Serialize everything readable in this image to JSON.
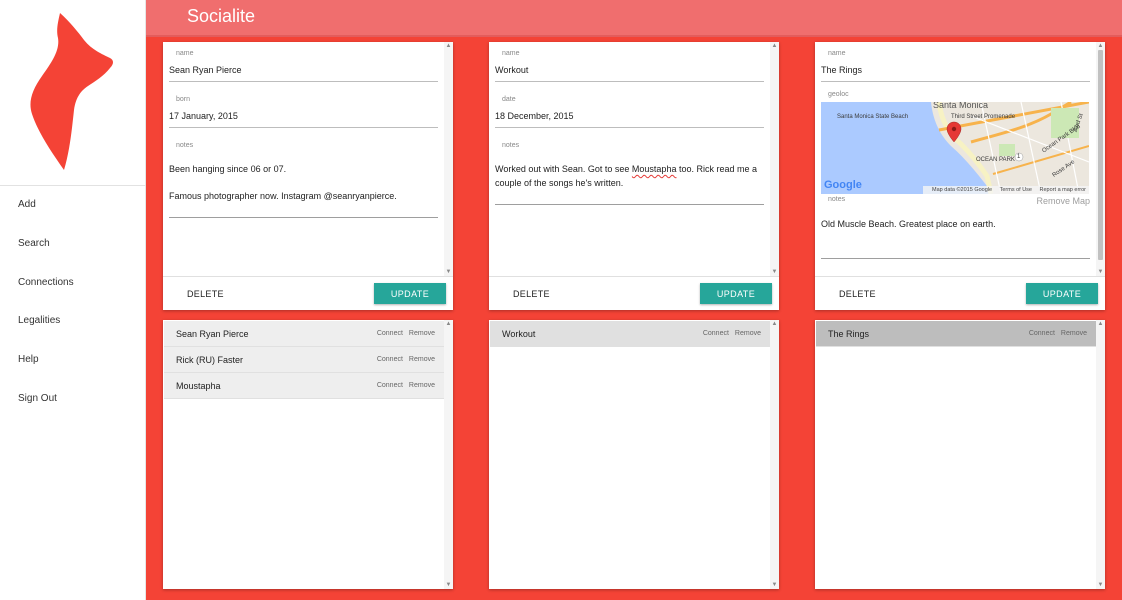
{
  "app": {
    "title": "Socialite"
  },
  "sidebar": {
    "items": [
      {
        "label": "Add"
      },
      {
        "label": "Search"
      },
      {
        "label": "Connections"
      },
      {
        "label": "Legalities"
      },
      {
        "label": "Help"
      },
      {
        "label": "Sign Out"
      }
    ]
  },
  "cards": [
    {
      "name_label": "name",
      "name_value": "Sean Ryan Pierce",
      "second_label": "born",
      "second_value": "17 January, 2015",
      "notes_label": "notes",
      "notes": [
        "Been hanging since 06 or 07.",
        "Famous photographer now. Instagram @seanryanpierce."
      ],
      "delete_label": "DELETE",
      "update_label": "UPDATE"
    },
    {
      "name_label": "name",
      "name_value": "Workout",
      "second_label": "date",
      "second_value": "18 December, 2015",
      "notes_label": "notes",
      "notes_parts": [
        "Worked out with Sean. Got to see ",
        "Moustapha",
        " too. Rick read me a couple of the songs he's written."
      ],
      "delete_label": "DELETE",
      "update_label": "UPDATE"
    },
    {
      "name_label": "name",
      "name_value": "The Rings",
      "second_label": "geoloc",
      "notes_label": "notes",
      "notes": [
        "Old Muscle Beach. Greatest place on earth."
      ],
      "remove_map_label": "Remove Map",
      "map": {
        "labels": {
          "city": "Santa Monica",
          "beach": "Santa Monica State Beach",
          "promenade": "Third Street Promenade",
          "ocean_park_blvd": "Ocean Park Blvd",
          "ocean_park": "OCEAN PARK",
          "rose_ave": "Rose Ave",
          "street_23": "23rd St",
          "route_1": "1"
        },
        "google": "Google",
        "footer": [
          "Map data ©2015 Google",
          "Terms of Use",
          "Report a map error"
        ]
      },
      "delete_label": "DELETE",
      "update_label": "UPDATE"
    }
  ],
  "lists": [
    {
      "items": [
        {
          "label": "Sean Ryan Pierce",
          "connect": "Connect",
          "remove": "Remove"
        },
        {
          "label": "Rick (RU) Faster",
          "connect": "Connect",
          "remove": "Remove"
        },
        {
          "label": "Moustapha",
          "connect": "Connect",
          "remove": "Remove"
        }
      ]
    },
    {
      "items": [
        {
          "label": "Workout",
          "connect": "Connect",
          "remove": "Remove"
        }
      ]
    },
    {
      "items": [
        {
          "label": "The Rings",
          "connect": "Connect",
          "remove": "Remove"
        }
      ]
    }
  ],
  "colors": {
    "header": "#f06e6e",
    "background": "#f44336",
    "button": "#26a69a",
    "logo": "#f44336"
  }
}
